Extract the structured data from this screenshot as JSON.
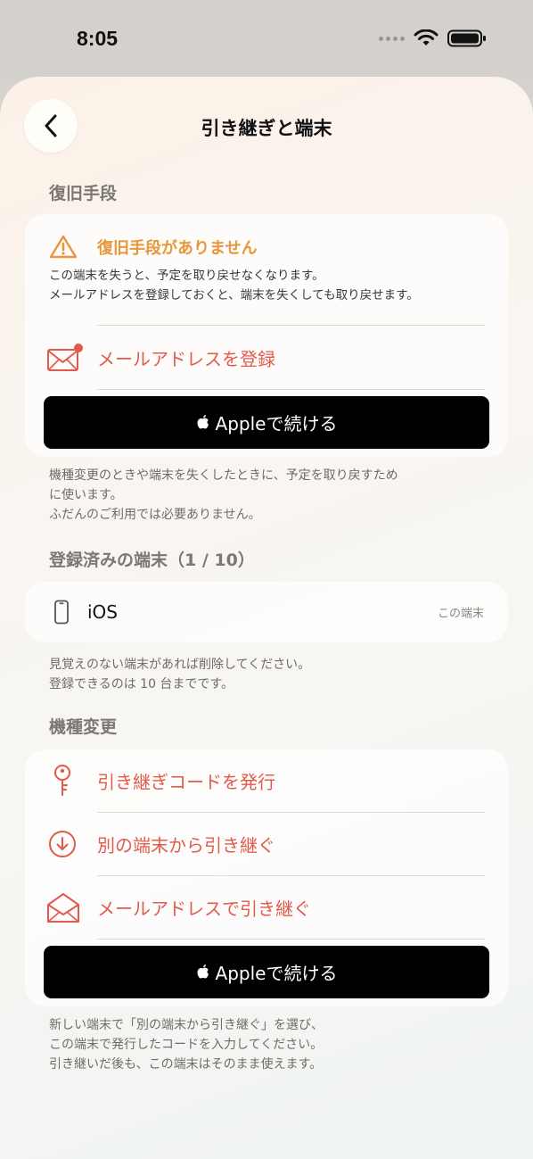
{
  "status_bar": {
    "time": "8:05"
  },
  "nav": {
    "title": "引き継ぎと端末"
  },
  "recovery": {
    "header": "復旧手段",
    "warning_title": "復旧手段がありません",
    "warning_line1": "この端末を失うと、予定を取り戻せなくなります。",
    "warning_line2": "メールアドレスを登録しておくと、端末を失くしても取り戻せます。",
    "register_email_label": "メールアドレスを登録",
    "apple_button_label": "Appleで続ける",
    "footnote_line1": "機種変更のときや端末を失くしたときに、予定を取り戻すため",
    "footnote_line2": "に使います。",
    "footnote_line3": "ふだんのご利用では必要ありません。"
  },
  "devices": {
    "header": "登録済みの端末（1 / 10）",
    "items": [
      {
        "name": "iOS",
        "tag": "この端末"
      }
    ],
    "footnote_line1": "見覚えのない端末があれば削除してください。",
    "footnote_line2": "登録できるのは 10 台までです。"
  },
  "migration": {
    "header": "機種変更",
    "items": [
      {
        "label": "引き継ぎコードを発行",
        "icon": "key-icon"
      },
      {
        "label": "別の端末から引き継ぐ",
        "icon": "download-circle-icon"
      },
      {
        "label": "メールアドレスで引き継ぐ",
        "icon": "envelope-open-icon"
      }
    ],
    "apple_button_label": "Appleで続ける",
    "footnote_line1": "新しい端末で「別の端末から引き継ぐ」を選び、",
    "footnote_line2": "この端末で発行したコードを入力してください。",
    "footnote_line3": "引き継いだ後も、この端末はそのまま使えます。"
  },
  "colors": {
    "accent": "#e25a4b",
    "warning": "#e8963a",
    "button_bg": "#000000"
  }
}
